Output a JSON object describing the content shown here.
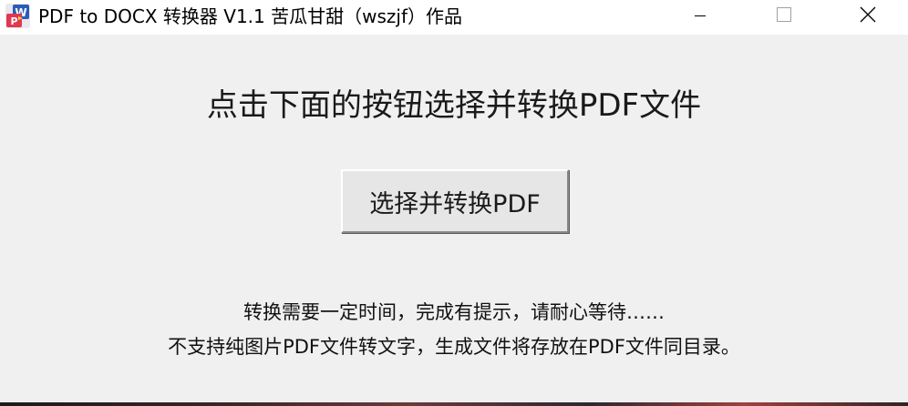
{
  "window": {
    "title": "PDF to DOCX 转换器 V1.1 苦瓜甘甜（wszjf）作品",
    "app_icon": "word-pdf-app-icon",
    "controls": {
      "minimize_icon": "minimize-icon",
      "maximize_icon": "maximize-icon",
      "close_icon": "close-icon"
    }
  },
  "main": {
    "heading": "点击下面的按钮选择并转换PDF文件",
    "convert_button_label": "选择并转换PDF",
    "info_line1": "转换需要一定时间，完成有提示，请耐心等待……",
    "info_line2": "不支持纯图片PDF文件转文字，生成文件将存放在PDF文件同目录。"
  },
  "colors": {
    "titlebar": "#ffffff",
    "window_background": "#f0f0f0",
    "button_face": "#e6e6e6",
    "text": "#1a1a1a"
  }
}
